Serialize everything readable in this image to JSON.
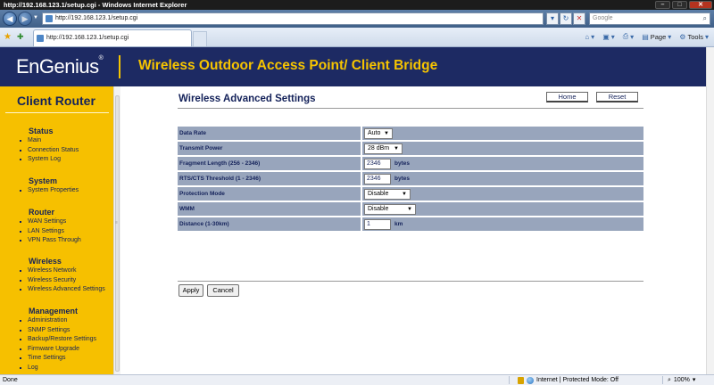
{
  "browser": {
    "window_title": "http://192.168.123.1/setup.cgi - Windows Internet Explorer",
    "address": "http://192.168.123.1/setup.cgi",
    "search_placeholder": "Google",
    "tab_title": "http://192.168.123.1/setup.cgi",
    "command_bar": {
      "page_label": "Page",
      "tools_label": "Tools"
    }
  },
  "banner": {
    "logo": "EnGenius",
    "title": "Wireless Outdoor Access Point/ Client Bridge"
  },
  "sidebar": {
    "title": "Client Router",
    "sections": [
      {
        "heading": "Status",
        "items": [
          "Main",
          "Connection Status",
          "System Log"
        ]
      },
      {
        "heading": "System",
        "items": [
          "System Properties"
        ]
      },
      {
        "heading": "Router",
        "items": [
          "WAN Settings",
          "LAN Settings",
          "VPN Pass Through"
        ]
      },
      {
        "heading": "Wireless",
        "items": [
          "Wireless Network",
          "Wireless Security",
          "Wireless Advanced Settings"
        ]
      },
      {
        "heading": "Management",
        "items": [
          "Administration",
          "SNMP Settings",
          "Backup/Restore Settings",
          "Firmware Upgrade",
          "Time Settings",
          "Log"
        ]
      }
    ]
  },
  "main": {
    "title": "Wireless Advanced Settings",
    "home_button": "Home",
    "reset_button": "Reset",
    "fields": {
      "data_rate": {
        "label": "Data Rate",
        "value": "Auto"
      },
      "transmit_power": {
        "label": "Transmit Power",
        "value": "28 dBm"
      },
      "fragment_length": {
        "label": "Fragment Length (256 - 2346)",
        "value": "2346",
        "unit": "bytes"
      },
      "rts_cts": {
        "label": "RTS/CTS Threshold (1 - 2346)",
        "value": "2346",
        "unit": "bytes"
      },
      "protection_mode": {
        "label": "Protection Mode",
        "value": "Disable"
      },
      "wmm": {
        "label": "WMM",
        "value": "Disable"
      },
      "distance": {
        "label": "Distance (1-30km)",
        "value": "1",
        "unit": "km"
      }
    },
    "apply_button": "Apply",
    "cancel_button": "Cancel"
  },
  "statusbar": {
    "left_text": "Done",
    "zone_text": "Internet | Protected Mode: Off",
    "zoom": "100%"
  }
}
